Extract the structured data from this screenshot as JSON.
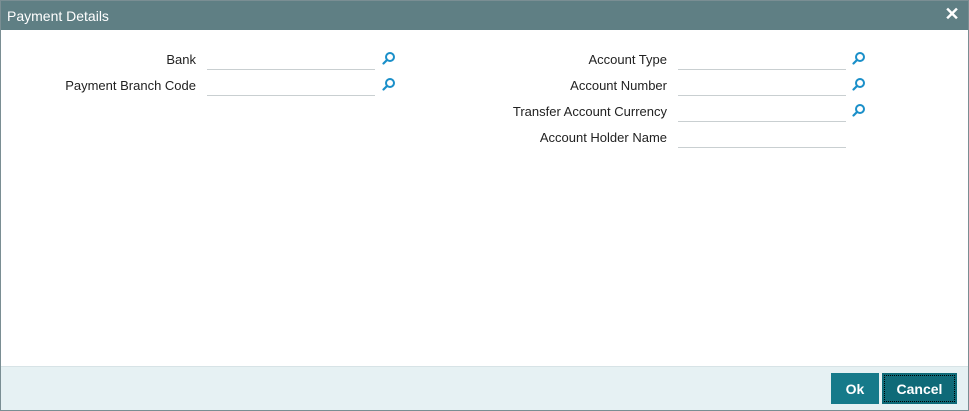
{
  "dialog": {
    "title": "Payment Details",
    "close_symbol": "✕"
  },
  "left_fields": [
    {
      "label": "Bank",
      "value": "",
      "has_lookup": true,
      "icon": "search-icon"
    },
    {
      "label": "Payment Branch Code",
      "value": "",
      "has_lookup": true,
      "icon": "search-icon"
    }
  ],
  "right_fields": [
    {
      "label": "Account Type",
      "value": "",
      "has_lookup": true,
      "icon": "search-icon"
    },
    {
      "label": "Account Number",
      "value": "",
      "has_lookup": true,
      "icon": "search-icon"
    },
    {
      "label": "Transfer Account Currency",
      "value": "",
      "has_lookup": true,
      "icon": "search-icon"
    },
    {
      "label": "Account Holder Name",
      "value": "",
      "has_lookup": false
    }
  ],
  "footer": {
    "ok_label": "Ok",
    "cancel_label": "Cancel"
  },
  "colors": {
    "titlebar": "#5f7f84",
    "button": "#167a8a",
    "lookup_icon": "#1a8fc9",
    "footer_bg": "#e6f1f3"
  }
}
